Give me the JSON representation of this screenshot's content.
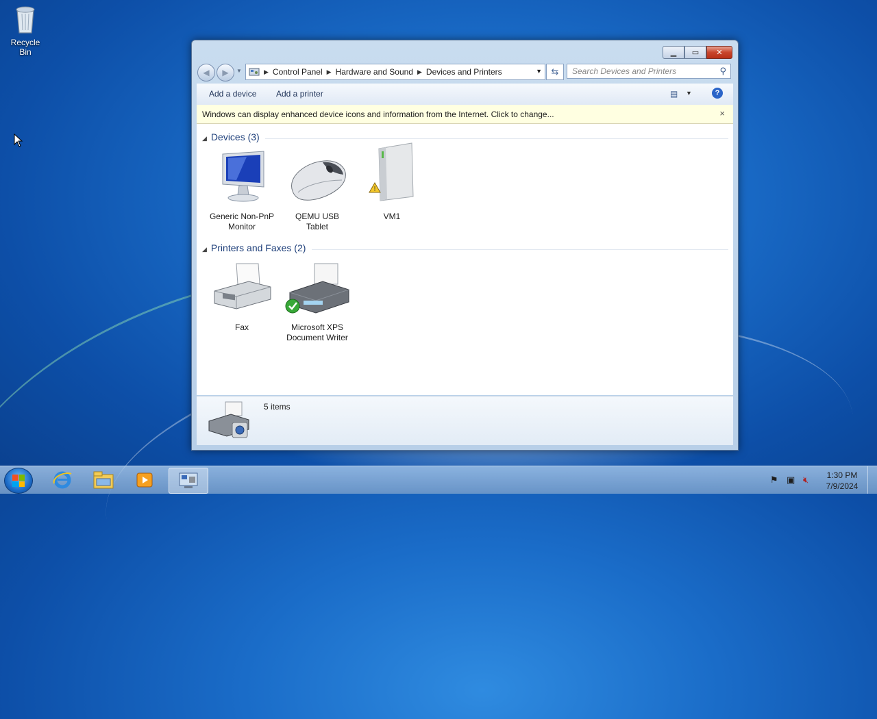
{
  "desktop": {
    "icons": [
      {
        "label": "Recycle Bin",
        "icon": "recycle-bin-icon"
      }
    ]
  },
  "window": {
    "address": {
      "crumbs": [
        "Control Panel",
        "Hardware and Sound",
        "Devices and Printers"
      ]
    },
    "search": {
      "placeholder": "Search Devices and Printers"
    },
    "toolbar": {
      "add_device": "Add a device",
      "add_printer": "Add a printer"
    },
    "infobar": {
      "message": "Windows can display enhanced device icons and information from the Internet. Click to change...",
      "close": "×"
    },
    "groups": [
      {
        "title": "Devices (3)",
        "items": [
          {
            "line1": "Generic Non-PnP",
            "line2": "Monitor",
            "icon": "monitor-icon"
          },
          {
            "line1": "QEMU USB",
            "line2": "Tablet",
            "icon": "mouse-icon"
          },
          {
            "line1": "VM1",
            "line2": "",
            "icon": "computer-tower-icon",
            "badge": "warning"
          }
        ]
      },
      {
        "title": "Printers and Faxes (2)",
        "items": [
          {
            "line1": "Fax",
            "line2": "",
            "icon": "fax-icon"
          },
          {
            "line1": "Microsoft XPS",
            "line2": "Document Writer",
            "icon": "printer-icon",
            "badge": "default-check"
          }
        ]
      }
    ],
    "details": {
      "count": "5 items"
    }
  },
  "taskbar": {
    "clock": {
      "time": "1:30 PM",
      "date": "7/9/2024"
    },
    "apps": [
      "internet-explorer-icon",
      "file-explorer-icon",
      "media-player-icon",
      "devices-printers-icon"
    ]
  },
  "colors": {
    "accent": "#1e3f7a",
    "infobar": "#ffffe1",
    "close": "#c8452c"
  }
}
